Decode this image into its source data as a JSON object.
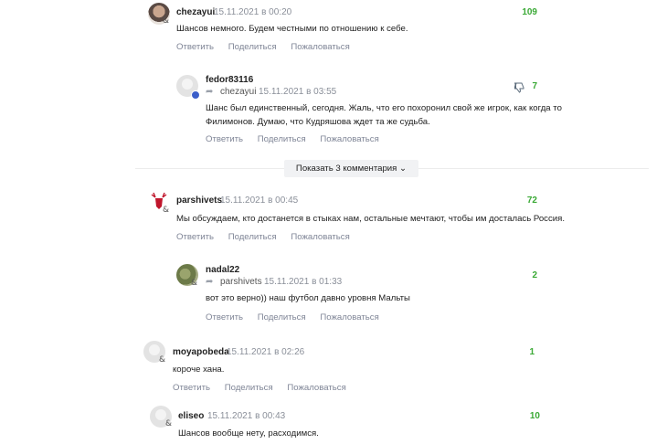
{
  "show_more_label": "Показать 3 комментария",
  "actions": {
    "reply": "Ответить",
    "share": "Поделиться",
    "report": "Пожаловаться"
  },
  "comments": [
    {
      "author": "chezayui",
      "time": "15.11.2021 в 00:20",
      "score": "109",
      "text": "Шансов немного. Будем честными по отношению к себе."
    },
    {
      "author": "fedor83116",
      "reply_to": "chezayui",
      "time": "15.11.2021 в 03:55",
      "score": "7",
      "text_lines": [
        "Шанс был единственный, сегодня. Жаль, что его похоронил свой же игрок, как когда то",
        "Филимонов. Думаю, что Кудряшова ждет та же судьба."
      ]
    },
    {
      "author": "parshivets",
      "time": "15.11.2021 в 00:45",
      "score": "72",
      "text": "Мы обсуждаем, кто достанется в стыках нам, остальные мечтают, чтобы им досталась Россия."
    },
    {
      "author": "nadal22",
      "reply_to": "parshivets",
      "time": "15.11.2021 в 01:33",
      "score": "2",
      "text": "вот это верно)) наш футбол давно уровня Мальты"
    },
    {
      "author": "moyapobeda",
      "time": "15.11.2021 в 02:26",
      "score": "1",
      "text": "короче хана."
    },
    {
      "author": "eliseo",
      "time": "15.11.2021 в 00:43",
      "score": "10",
      "text": "Шансов вообще нету, расходимся."
    }
  ],
  "badge_symbol": "&",
  "reply_arrow": "➦",
  "colors": {
    "score": "#3aa935",
    "action": "#7f8596",
    "timestamp": "#8a8f99",
    "facebook": "#3b5ec9"
  }
}
